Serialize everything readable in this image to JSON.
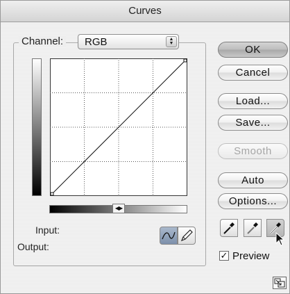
{
  "window": {
    "title": "Curves"
  },
  "channel": {
    "label": "Channel:",
    "value": "RGB"
  },
  "io": {
    "input_label": "Input:",
    "output_label": "Output:"
  },
  "buttons": {
    "ok": "OK",
    "cancel": "Cancel",
    "load": "Load...",
    "save": "Save...",
    "smooth": "Smooth",
    "auto": "Auto",
    "options": "Options..."
  },
  "preview": {
    "label": "Preview",
    "checked": true
  },
  "icons": {
    "channel_select": "stepper-arrows-icon",
    "curve_tool": "curve-tool-icon",
    "pencil_tool": "pencil-tool-icon",
    "black_eyedropper": "eyedropper-black-icon",
    "gray_eyedropper": "eyedropper-gray-icon",
    "white_eyedropper": "eyedropper-white-icon",
    "cursor": "arrow-cursor-icon",
    "gradient_toggle": "gradient-direction-icon",
    "resize": "resize-grip-icon"
  },
  "colors": {
    "selected_tool": "#8fa1bb"
  }
}
